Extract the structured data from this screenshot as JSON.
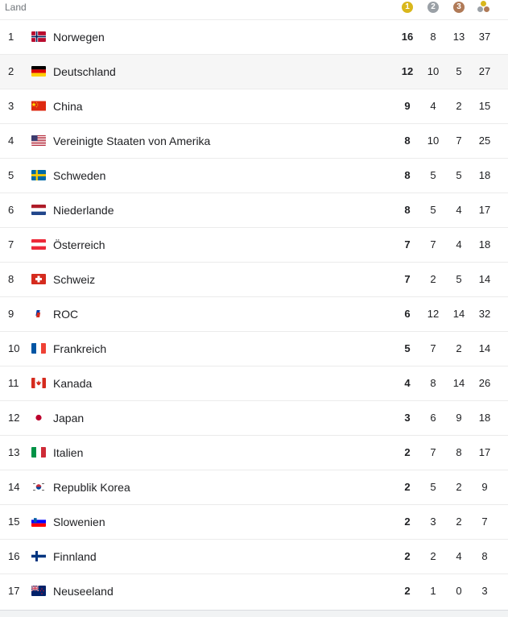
{
  "header": {
    "land_label": "Land",
    "gold": "1",
    "silver": "2",
    "bronze": "3"
  },
  "colors": {
    "gold": "#d9b71c",
    "silver": "#9aa0a6",
    "bronze": "#b07a57",
    "highlight_row": "#f6f6f6"
  },
  "rows": [
    {
      "rank": "1",
      "country": "Norwegen",
      "flag": "norway-flag-icon",
      "gold": "16",
      "silver": "8",
      "bronze": "13",
      "total": "37"
    },
    {
      "rank": "2",
      "country": "Deutschland",
      "flag": "germany-flag-icon",
      "gold": "12",
      "silver": "10",
      "bronze": "5",
      "total": "27"
    },
    {
      "rank": "3",
      "country": "China",
      "flag": "china-flag-icon",
      "gold": "9",
      "silver": "4",
      "bronze": "2",
      "total": "15"
    },
    {
      "rank": "4",
      "country": "Vereinigte Staaten von Amerika",
      "flag": "usa-flag-icon",
      "gold": "8",
      "silver": "10",
      "bronze": "7",
      "total": "25"
    },
    {
      "rank": "5",
      "country": "Schweden",
      "flag": "sweden-flag-icon",
      "gold": "8",
      "silver": "5",
      "bronze": "5",
      "total": "18"
    },
    {
      "rank": "6",
      "country": "Niederlande",
      "flag": "netherlands-flag-icon",
      "gold": "8",
      "silver": "5",
      "bronze": "4",
      "total": "17"
    },
    {
      "rank": "7",
      "country": "Österreich",
      "flag": "austria-flag-icon",
      "gold": "7",
      "silver": "7",
      "bronze": "4",
      "total": "18"
    },
    {
      "rank": "8",
      "country": "Schweiz",
      "flag": "switzerland-flag-icon",
      "gold": "7",
      "silver": "2",
      "bronze": "5",
      "total": "14"
    },
    {
      "rank": "9",
      "country": "ROC",
      "flag": "roc-flag-icon",
      "gold": "6",
      "silver": "12",
      "bronze": "14",
      "total": "32"
    },
    {
      "rank": "10",
      "country": "Frankreich",
      "flag": "france-flag-icon",
      "gold": "5",
      "silver": "7",
      "bronze": "2",
      "total": "14"
    },
    {
      "rank": "11",
      "country": "Kanada",
      "flag": "canada-flag-icon",
      "gold": "4",
      "silver": "8",
      "bronze": "14",
      "total": "26"
    },
    {
      "rank": "12",
      "country": "Japan",
      "flag": "japan-flag-icon",
      "gold": "3",
      "silver": "6",
      "bronze": "9",
      "total": "18"
    },
    {
      "rank": "13",
      "country": "Italien",
      "flag": "italy-flag-icon",
      "gold": "2",
      "silver": "7",
      "bronze": "8",
      "total": "17"
    },
    {
      "rank": "14",
      "country": "Republik Korea",
      "flag": "korea-flag-icon",
      "gold": "2",
      "silver": "5",
      "bronze": "2",
      "total": "9"
    },
    {
      "rank": "15",
      "country": "Slowenien",
      "flag": "slovenia-flag-icon",
      "gold": "2",
      "silver": "3",
      "bronze": "2",
      "total": "7"
    },
    {
      "rank": "16",
      "country": "Finnland",
      "flag": "finland-flag-icon",
      "gold": "2",
      "silver": "2",
      "bronze": "4",
      "total": "8"
    },
    {
      "rank": "17",
      "country": "Neuseeland",
      "flag": "new-zealand-flag-icon",
      "gold": "2",
      "silver": "1",
      "bronze": "0",
      "total": "3"
    }
  ]
}
